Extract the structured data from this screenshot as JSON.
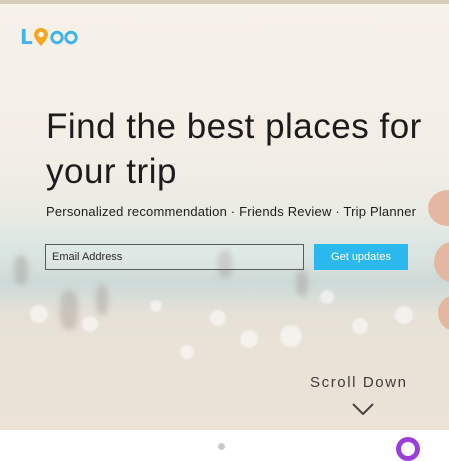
{
  "brand": {
    "logo_text": "Loco"
  },
  "hero": {
    "headline": "Find the best places for your trip",
    "features": "Personalized recommendation · Friends Review · Trip Planner"
  },
  "signup": {
    "email_placeholder": "Email Address",
    "button_label": "Get updates"
  },
  "scroll": {
    "label": "Scroll Down"
  },
  "icons": {
    "logo": "location-pin-logo",
    "scroll": "chevron-down-icon",
    "badge": "chat-badge-icon"
  },
  "colors": {
    "accent": "#2bb8ee",
    "logo_blue": "#43b4ea",
    "logo_orange": "#f5a623",
    "badge_purple": "#9b3fd8",
    "text": "#1c1c1c"
  }
}
